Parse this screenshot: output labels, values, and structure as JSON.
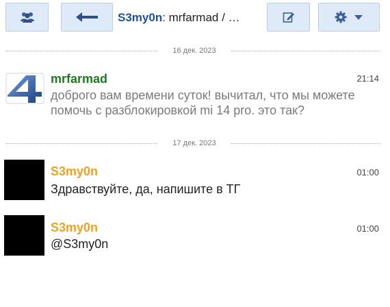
{
  "header": {
    "nick": "S3my0n",
    "title_rest": ": mrfarmad / …"
  },
  "icons": {
    "users": "users-icon",
    "back": "back-arrow-icon",
    "edit": "edit-icon",
    "gear": "gear-icon",
    "caret": "caret-down-icon"
  },
  "dates": [
    "16 дек. 2023",
    "17 дек. 2023"
  ],
  "messages": [
    {
      "author": "mrfarmad",
      "time": "21:14",
      "text": "доброго вам времени суток! вычитал, что мы можете помочь с разблокировкой mi 14 pro. это так?"
    },
    {
      "author": "S3my0n",
      "time": "01:00",
      "text": "Здравствуйте, да, напишите в ТГ"
    },
    {
      "author": "S3my0n",
      "time": "01:00",
      "text": "@S3my0n"
    }
  ],
  "colors": {
    "button_bg": "#dfeaf9",
    "nick_blue": "#1f4f9a",
    "author_green": "#1e7a1e",
    "author_orange": "#f0a020"
  }
}
